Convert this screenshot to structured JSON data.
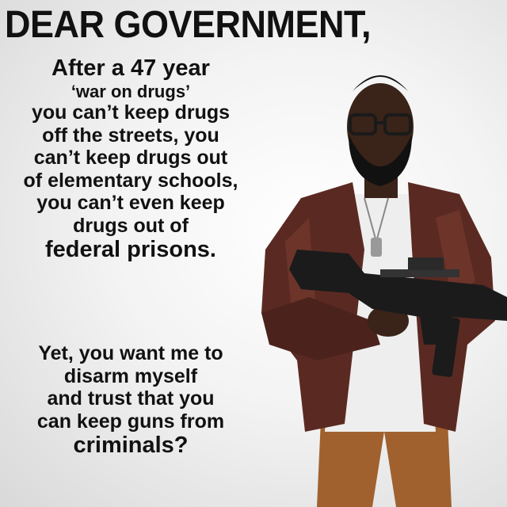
{
  "headline": "DEAR GOVERNMENT,",
  "paragraph1": [
    "After a 47 year",
    "‘war on drugs’",
    "you can’t keep drugs",
    "off the streets, you",
    "can’t keep drugs out",
    "of elementary schools,",
    "you can’t even keep",
    "drugs out of",
    "federal prisons."
  ],
  "paragraph2": [
    "Yet, you want me to",
    "disarm myself",
    "and trust that you",
    "can keep guns from",
    "criminals?"
  ],
  "colors": {
    "text": "#111111",
    "jacket": "#5a2a22",
    "shirt": "#eeeeee",
    "pants": "#a0612f",
    "rifle": "#1b1b1b"
  }
}
